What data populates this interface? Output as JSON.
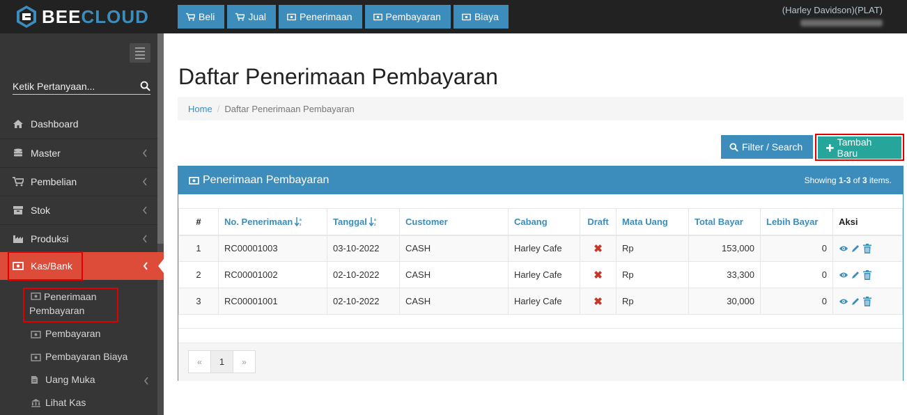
{
  "brand": {
    "part1": "BEE",
    "part2": "CLOUD"
  },
  "topnav": [
    {
      "label": "Beli",
      "icon": "cart-icon"
    },
    {
      "label": "Jual",
      "icon": "cart-icon"
    },
    {
      "label": "Penerimaan",
      "icon": "money-icon"
    },
    {
      "label": "Pembayaran",
      "icon": "money-icon"
    },
    {
      "label": "Biaya",
      "icon": "money-icon"
    }
  ],
  "user": {
    "name": "(Harley Davidson)(PLAT)"
  },
  "sidebar": {
    "search_placeholder": "Ketik Pertanyaan...",
    "items": [
      {
        "label": "Dashboard",
        "icon": "home-icon"
      },
      {
        "label": "Master",
        "icon": "database-icon"
      },
      {
        "label": "Pembelian",
        "icon": "cart-icon"
      },
      {
        "label": "Stok",
        "icon": "archive-icon"
      },
      {
        "label": "Produksi",
        "icon": "industry-icon"
      },
      {
        "label": "Kas/Bank",
        "icon": "money-icon"
      }
    ],
    "subitems": [
      {
        "label": "Penerimaan Pembayaran",
        "line1": "Penerimaan",
        "line2": "Pembayaran",
        "icon": "money-icon"
      },
      {
        "label": "Pembayaran",
        "icon": "money-icon"
      },
      {
        "label": "Pembayaran Biaya",
        "icon": "money-icon"
      },
      {
        "label": "Uang Muka",
        "icon": "file-icon"
      },
      {
        "label": "Lihat Kas",
        "icon": "bank-icon"
      }
    ],
    "active_color": "#dd4b39"
  },
  "page": {
    "title": "Daftar Penerimaan Pembayaran",
    "breadcrumb": {
      "home": "Home",
      "current": "Daftar Penerimaan Pembayaran"
    },
    "filter_button": "Filter / Search",
    "add_button": "Tambah Baru"
  },
  "panel": {
    "title": "Penerimaan Pembayaran",
    "summary_prefix": "Showing ",
    "summary_range": "1-3",
    "summary_mid": " of ",
    "summary_total": "3",
    "summary_suffix": " items."
  },
  "table": {
    "headers": [
      "#",
      "No. Penerimaan",
      "Tanggal",
      "Customer",
      "Cabang",
      "Draft",
      "Mata Uang",
      "Total Bayar",
      "Lebih Bayar",
      "Aksi"
    ],
    "rows": [
      {
        "no": "1",
        "number": "RC00001003",
        "date": "03-10-2022",
        "customer": "CASH",
        "branch": "Harley Cafe",
        "draft": "✖",
        "currency": "Rp",
        "total": "153,000",
        "over": "0"
      },
      {
        "no": "2",
        "number": "RC00001002",
        "date": "02-10-2022",
        "customer": "CASH",
        "branch": "Harley Cafe",
        "draft": "✖",
        "currency": "Rp",
        "total": "33,300",
        "over": "0"
      },
      {
        "no": "3",
        "number": "RC00001001",
        "date": "02-10-2022",
        "customer": "CASH",
        "branch": "Harley Cafe",
        "draft": "✖",
        "currency": "Rp",
        "total": "30,000",
        "over": "0"
      }
    ]
  },
  "pager": {
    "prev": "«",
    "current": "1",
    "next": "»"
  },
  "colors": {
    "primary": "#3c8dbc",
    "success": "#26a69a",
    "danger": "#dd4b39",
    "topbar": "#222222",
    "sidebar": "#363636"
  }
}
